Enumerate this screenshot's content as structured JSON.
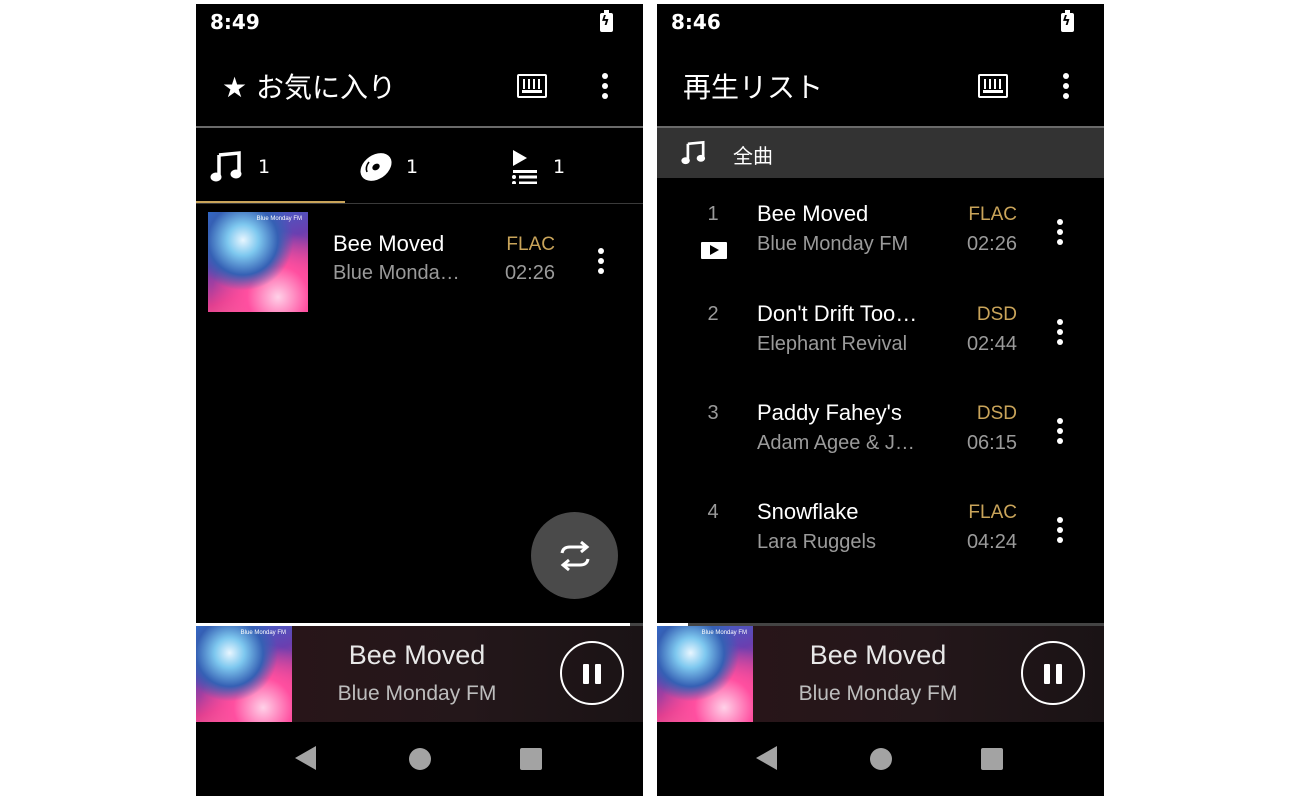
{
  "left_phone": {
    "status": {
      "time": "8:49"
    },
    "appbar": {
      "title": "★ お気に入り"
    },
    "tabs": [
      {
        "icon": "music-note-icon",
        "count": "1",
        "selected": true
      },
      {
        "icon": "disc-icon",
        "count": "1",
        "selected": false
      },
      {
        "icon": "playlist-icon",
        "count": "1",
        "selected": false
      }
    ],
    "item": {
      "title": "Bee Moved",
      "artist": "Blue Monda…",
      "format": "FLAC",
      "duration": "02:26",
      "album_art_text": "Blue Monday FM"
    },
    "progress_fraction": 0.97,
    "now_playing": {
      "title": "Bee Moved",
      "artist": "Blue Monday FM",
      "album_art_text": "Blue Monday FM"
    }
  },
  "right_phone": {
    "status": {
      "time": "8:46"
    },
    "appbar": {
      "title": "再生リスト"
    },
    "section": {
      "label": "全曲"
    },
    "tracks": [
      {
        "number": "1",
        "title": "Bee Moved",
        "artist": "Blue Monday FM",
        "format": "FLAC",
        "duration": "02:26"
      },
      {
        "number": "2",
        "title": "Don't Drift Too…",
        "artist": "Elephant Revival",
        "format": "DSD",
        "duration": "02:44"
      },
      {
        "number": "3",
        "title": "Paddy Fahey's",
        "artist": "Adam Agee & J…",
        "format": "DSD",
        "duration": "06:15"
      },
      {
        "number": "4",
        "title": "Snowflake",
        "artist": "Lara Ruggels",
        "format": "FLAC",
        "duration": "04:24"
      }
    ],
    "progress_fraction": 0.07,
    "now_playing": {
      "title": "Bee Moved",
      "artist": "Blue Monday FM",
      "album_art_text": "Blue Monday FM"
    }
  },
  "colors": {
    "accent_gold": "#c9a45a",
    "background": "#000000",
    "section_header": "#333333"
  }
}
